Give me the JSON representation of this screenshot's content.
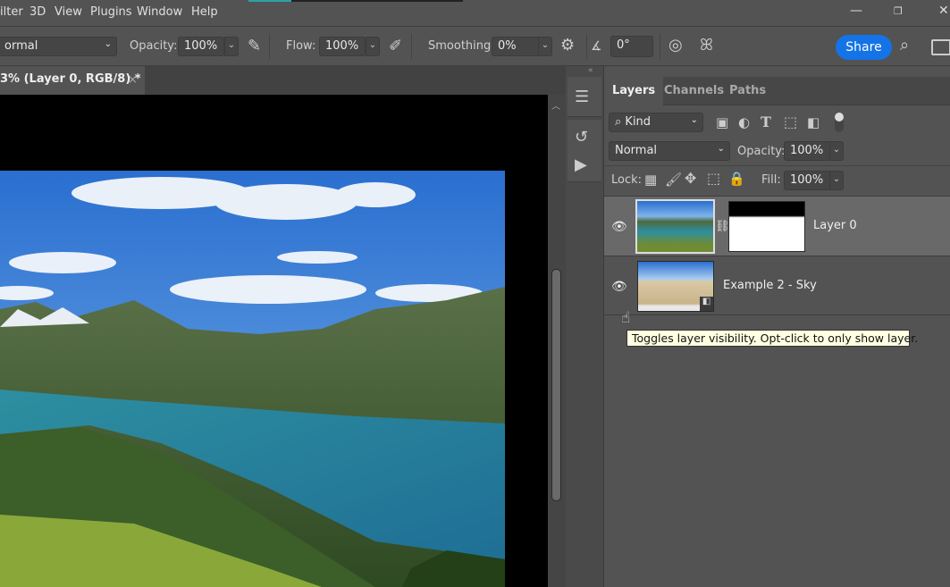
{
  "menu": {
    "items": [
      "ilter",
      "3D",
      "View",
      "Plugins",
      "Window",
      "Help"
    ]
  },
  "window_controls": {
    "minimize": "—",
    "restore": "❐",
    "close": "✕"
  },
  "options_bar": {
    "blend_mode": "ormal",
    "opacity_label": "Opacity:",
    "opacity_value": "100%",
    "flow_label": "Flow:",
    "flow_value": "100%",
    "smoothing_label": "Smoothing:",
    "smoothing_value": "0%",
    "angle_value": "0°",
    "share_label": "Share"
  },
  "document_tab": {
    "title": "3% (Layer 0, RGB/8) *",
    "close": "×"
  },
  "layers_panel": {
    "tabs": [
      "Layers",
      "Channels",
      "Paths"
    ],
    "active_tab": "Layers",
    "filter_kind": "Kind",
    "blend_mode": "Normal",
    "opacity_label": "Opacity:",
    "opacity_value": "100%",
    "lock_label": "Lock:",
    "fill_label": "Fill:",
    "fill_value": "100%",
    "layers": [
      {
        "name": "Layer 0",
        "visible": true,
        "selected": true,
        "has_mask": true
      },
      {
        "name": "Example 2 - Sky",
        "visible": true,
        "selected": false,
        "smart_object": true
      }
    ]
  },
  "tooltip": "Toggles layer visibility. Opt-click to only show layer.",
  "colors": {
    "accent": "#1473e6",
    "panel": "#535353",
    "tooltip_bg": "#ffffe1"
  }
}
